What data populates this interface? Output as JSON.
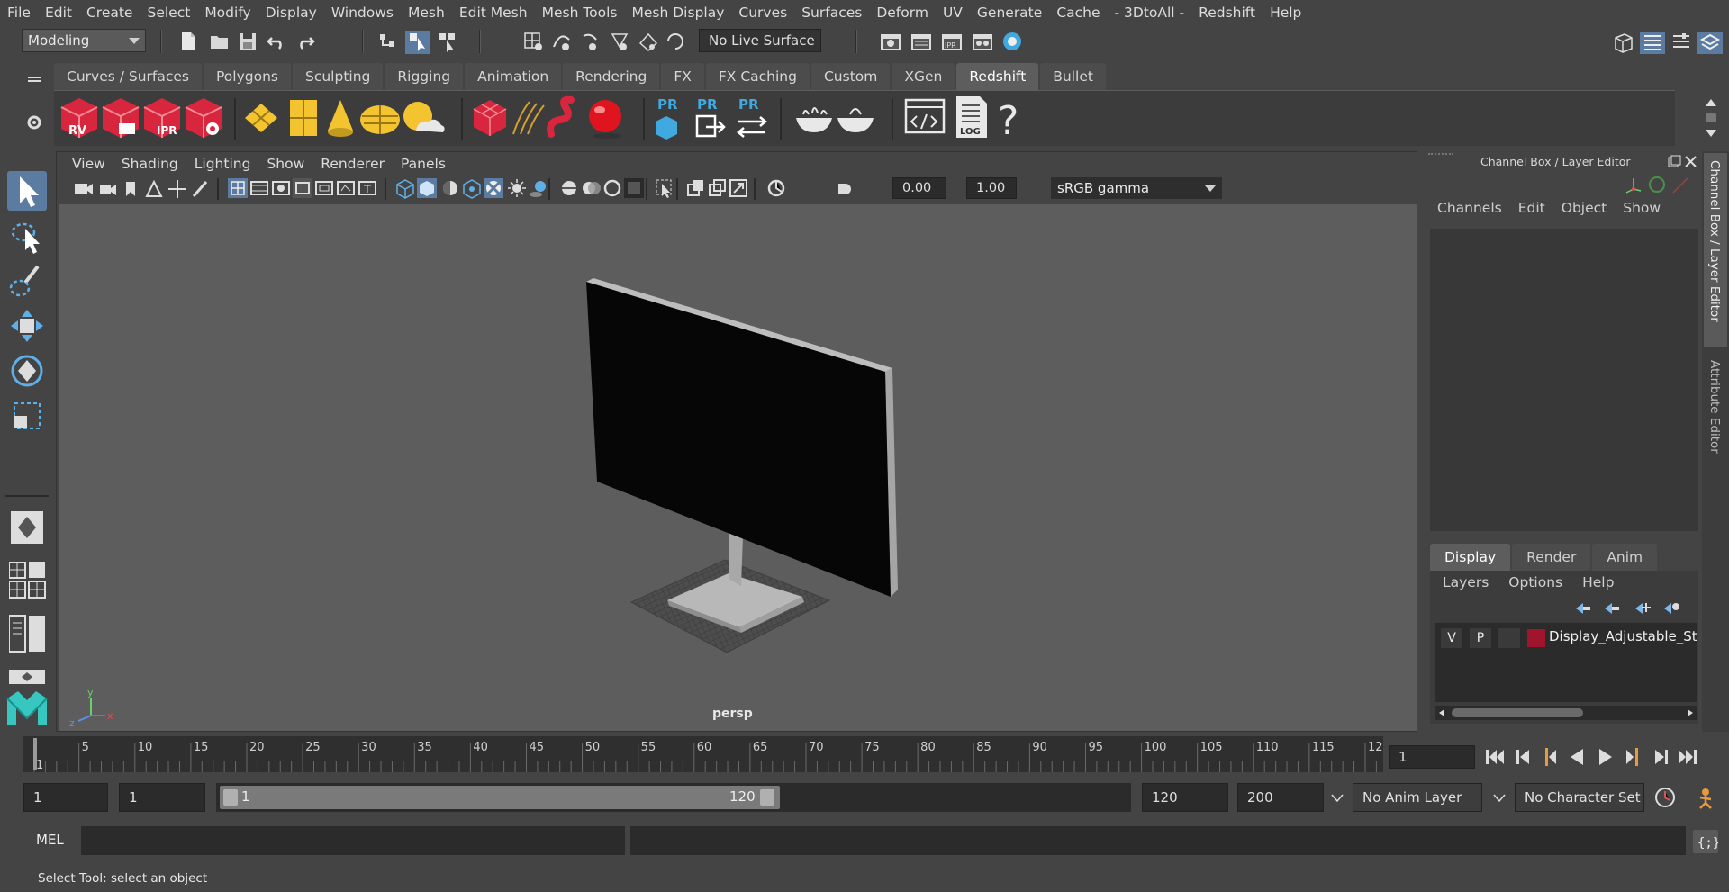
{
  "menubar": {
    "items": [
      "File",
      "Edit",
      "Create",
      "Select",
      "Modify",
      "Display",
      "Windows",
      "Mesh",
      "Edit Mesh",
      "Mesh Tools",
      "Mesh Display",
      "Curves",
      "Surfaces",
      "Deform",
      "UV",
      "Generate",
      "Cache",
      "- 3DtoAll -",
      "Redshift",
      "Help"
    ]
  },
  "statusline": {
    "mode_select": "Modeling",
    "live_surface": "No Live Surface"
  },
  "shelf": {
    "tabs": [
      "Curves / Surfaces",
      "Polygons",
      "Sculpting",
      "Rigging",
      "Animation",
      "Rendering",
      "FX",
      "FX Caching",
      "Custom",
      "XGen",
      "Redshift",
      "Bullet"
    ],
    "active_tab": "Redshift",
    "icon_labels": {
      "rv": "RV",
      "ipr": "IPR",
      "pr1": "PR",
      "pr2": "PR",
      "pr3": "PR",
      "log": "LOG",
      "help": "?"
    }
  },
  "viewport": {
    "menu": [
      "View",
      "Shading",
      "Lighting",
      "Show",
      "Renderer",
      "Panels"
    ],
    "exposure": "0.00",
    "gamma": "1.00",
    "color_space": "sRGB gamma",
    "camera_label": "persp",
    "axis_y": "y",
    "axis_x": "x",
    "axis_z": "z"
  },
  "channel_box": {
    "title": "Channel Box / Layer Editor",
    "menu": [
      "Channels",
      "Edit",
      "Object",
      "Show"
    ]
  },
  "layer_editor": {
    "tabs": [
      "Display",
      "Render",
      "Anim"
    ],
    "active_tab": "Display",
    "menu": [
      "Layers",
      "Options",
      "Help"
    ],
    "layer": {
      "v": "V",
      "p": "P",
      "name": "Display_Adjustable_Sta",
      "color": "#a0152e"
    }
  },
  "side_tabs": {
    "channel_box": "Channel Box / Layer Editor",
    "attribute_editor": "Attribute Editor"
  },
  "timeline": {
    "ticks": [
      "1",
      "5",
      "10",
      "15",
      "20",
      "25",
      "30",
      "35",
      "40",
      "45",
      "50",
      "55",
      "60",
      "65",
      "70",
      "75",
      "80",
      "85",
      "90",
      "95",
      "100",
      "105",
      "110",
      "115",
      "12"
    ],
    "current_frame": "1"
  },
  "range": {
    "start_field": "1",
    "playback_start": "1",
    "slider_start": "1",
    "slider_end": "120",
    "playback_end": "120",
    "end_field": "200",
    "anim_layer": "No Anim Layer",
    "character_set": "No Character Set"
  },
  "command_line": {
    "lang": "MEL"
  },
  "help_line": {
    "text": "Select Tool: select an object"
  },
  "colors": {
    "accent": "#5b7ca0",
    "redshift_red": "#d7263d",
    "shelf_yellow": "#f4c430",
    "pr_blue": "#3fa9e0"
  }
}
